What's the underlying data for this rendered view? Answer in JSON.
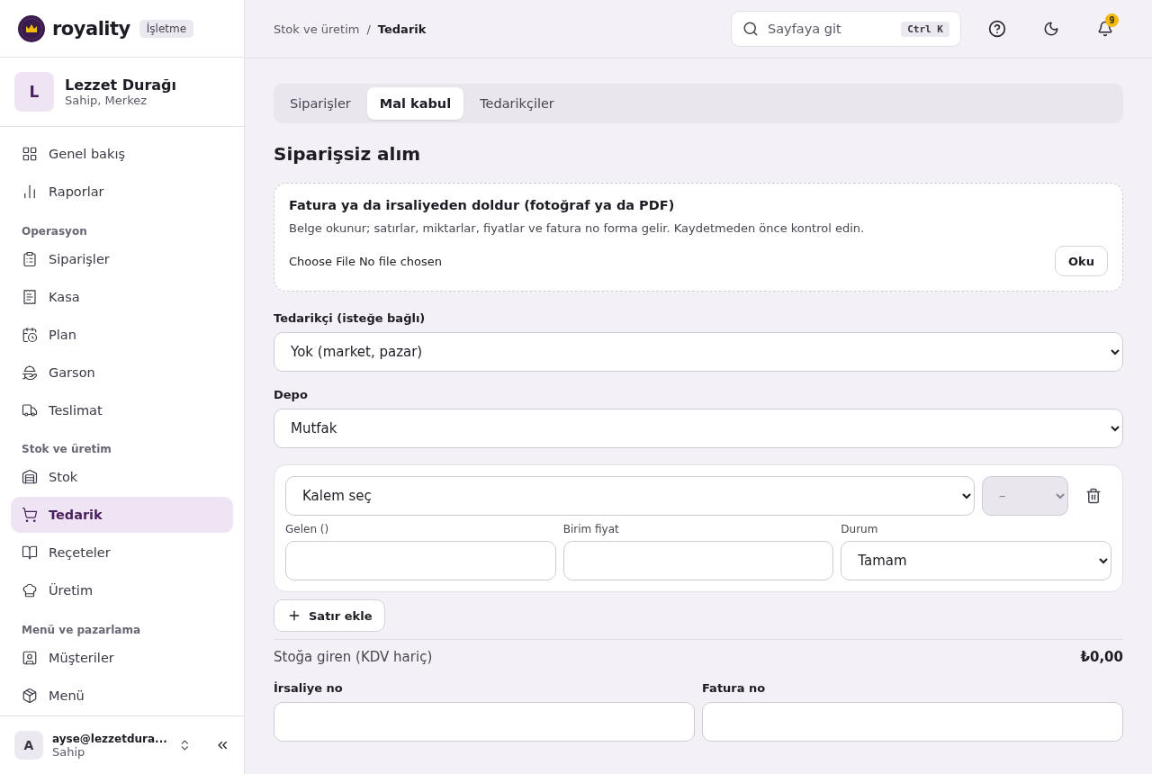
{
  "brand": {
    "name": "royality",
    "badge": "İşletme"
  },
  "business": {
    "initial": "L",
    "name": "Lezzet Durağı",
    "role": "Sahip, Merkez"
  },
  "nav": [
    {
      "items": [
        {
          "label": "Genel bakış",
          "selected": false
        },
        {
          "label": "Raporlar",
          "selected": false
        }
      ]
    },
    {
      "heading": "Operasyon",
      "items": [
        {
          "label": "Siparişler",
          "selected": false
        },
        {
          "label": "Kasa",
          "selected": false
        },
        {
          "label": "Plan",
          "selected": false
        },
        {
          "label": "Garson",
          "selected": false
        },
        {
          "label": "Teslimat",
          "selected": false
        }
      ]
    },
    {
      "heading": "Stok ve üretim",
      "items": [
        {
          "label": "Stok",
          "selected": false
        },
        {
          "label": "Tedarik",
          "selected": true
        },
        {
          "label": "Reçeteler",
          "selected": false
        },
        {
          "label": "Üretim",
          "selected": false
        }
      ]
    },
    {
      "heading": "Menü ve pazarlama",
      "items": [
        {
          "label": "Müşteriler",
          "selected": false
        },
        {
          "label": "Menü",
          "selected": false
        }
      ]
    }
  ],
  "user": {
    "initial": "A",
    "email": "ayse@lezzetdura...",
    "role": "Sahip"
  },
  "breadcrumb": {
    "parent": "Stok ve üretim",
    "separator": "/",
    "current": "Tedarik"
  },
  "search": {
    "placeholder": "Sayfaya git",
    "shortcut": "Ctrl K"
  },
  "notifications": {
    "count": "9"
  },
  "tabs": [
    {
      "label": "Siparişler",
      "selected": false
    },
    {
      "label": "Mal kabul",
      "selected": true
    },
    {
      "label": "Tedarikçiler",
      "selected": false
    }
  ],
  "page_title": "Siparişsiz alım",
  "import_card": {
    "title": "Fatura ya da irsaliyeden doldur (fotoğraf ya da PDF)",
    "description": "Belge okunur; satırlar, miktarlar, fiyatlar ve fatura no forma gelir. Kaydetmeden önce kontrol edin.",
    "file_button": "Choose File",
    "file_status": "No file chosen",
    "action": "Oku"
  },
  "supplier": {
    "label": "Tedarikçi (isteğe bağlı)",
    "value": "Yok (market, pazar)"
  },
  "warehouse": {
    "label": "Depo",
    "value": "Mutfak"
  },
  "line": {
    "item": "Kalem seç",
    "unit": "–",
    "unit_disabled": true,
    "qty_label": "Gelen ()",
    "price_label": "Birim fiyat",
    "status_label": "Durum",
    "status": "Tamam"
  },
  "add_row": "Satır ekle",
  "total": {
    "label": "Stoğa giren (KDV hariç)",
    "value": "₺0,00"
  },
  "fields": [
    {
      "label": "İrsaliye no"
    },
    {
      "label": "Fatura no"
    }
  ]
}
